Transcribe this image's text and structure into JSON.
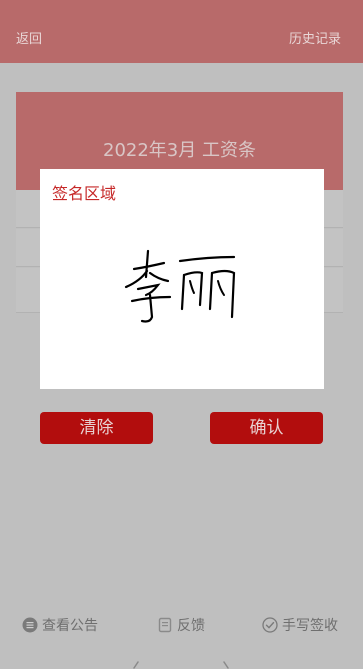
{
  "topbar": {
    "back_label": "返回",
    "history_label": "历史记录"
  },
  "card": {
    "title": "2022年3月 工资条"
  },
  "signature_panel": {
    "label": "签名区域",
    "signature_text": "李丽"
  },
  "actions": {
    "clear_label": "清除",
    "confirm_label": "确认"
  },
  "bottom_nav": {
    "items": [
      {
        "label": "查看公告",
        "icon": "list-icon"
      },
      {
        "label": "反馈",
        "icon": "feedback-icon"
      },
      {
        "label": "手写签收",
        "icon": "check-circle-icon"
      }
    ]
  },
  "colors": {
    "accent": "#b20d0d",
    "header_dimmed": "#b86a6a",
    "label_red": "#c62828"
  }
}
